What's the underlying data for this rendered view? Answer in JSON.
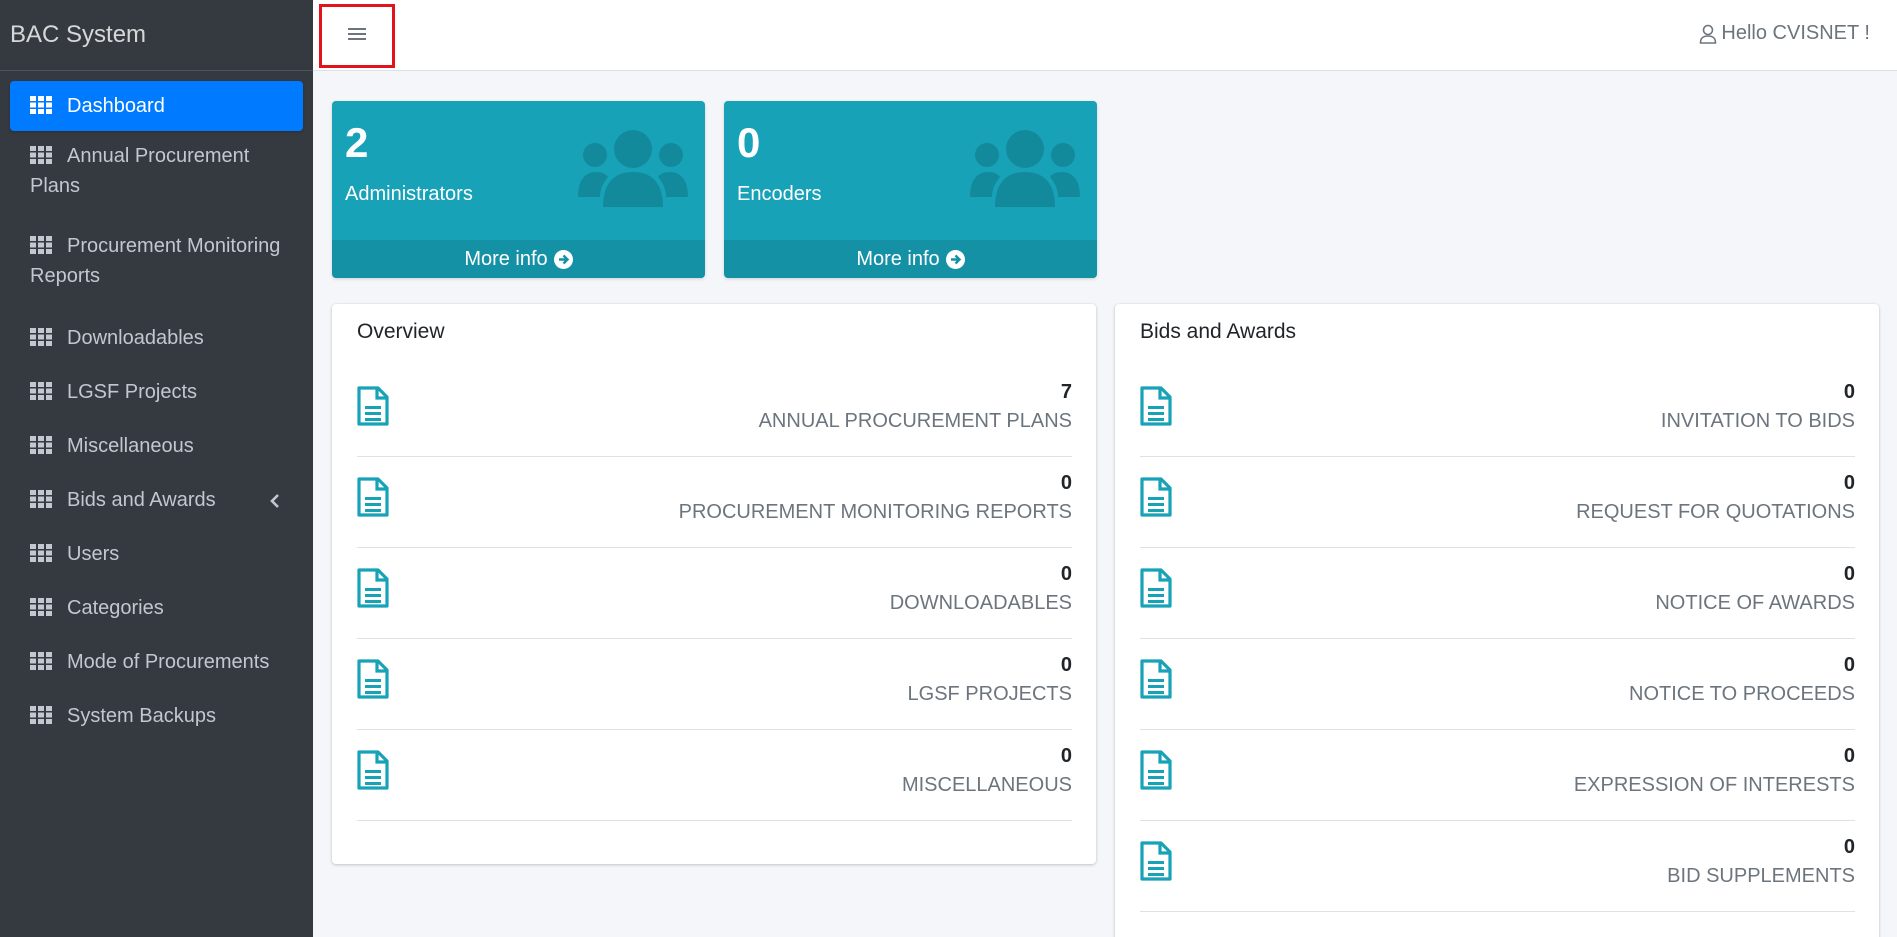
{
  "sidebar": {
    "brand": "BAC System",
    "items": [
      {
        "label": "Dashboard"
      },
      {
        "label": "Annual Procurement Plans"
      },
      {
        "label": "Procurement Monitoring Reports"
      },
      {
        "label": "Downloadables"
      },
      {
        "label": "LGSF Projects"
      },
      {
        "label": "Miscellaneous"
      },
      {
        "label": "Bids and Awards"
      },
      {
        "label": "Users"
      },
      {
        "label": "Categories"
      },
      {
        "label": "Mode of Procurements"
      },
      {
        "label": "System Backups"
      }
    ]
  },
  "header": {
    "user_greeting": "Hello CVISNET !"
  },
  "boxes": [
    {
      "count": "2",
      "label": "Administrators",
      "more": "More info"
    },
    {
      "count": "0",
      "label": "Encoders",
      "more": "More info"
    }
  ],
  "overview": {
    "title": "Overview",
    "rows": [
      {
        "count": "7",
        "label": "ANNUAL PROCUREMENT PLANS"
      },
      {
        "count": "0",
        "label": "PROCUREMENT MONITORING REPORTS"
      },
      {
        "count": "0",
        "label": "DOWNLOADABLES"
      },
      {
        "count": "0",
        "label": "LGSF PROJECTS"
      },
      {
        "count": "0",
        "label": "MISCELLANEOUS"
      }
    ]
  },
  "bids": {
    "title": "Bids and Awards",
    "rows": [
      {
        "count": "0",
        "label": "INVITATION TO BIDS"
      },
      {
        "count": "0",
        "label": "REQUEST FOR QUOTATIONS"
      },
      {
        "count": "0",
        "label": "NOTICE OF AWARDS"
      },
      {
        "count": "0",
        "label": "NOTICE TO PROCEEDS"
      },
      {
        "count": "0",
        "label": "EXPRESSION OF INTERESTS"
      },
      {
        "count": "0",
        "label": "BID SUPPLEMENTS"
      }
    ]
  },
  "colors": {
    "sidebar_bg": "#343a40",
    "active": "#007bff",
    "box": "#17a2b8",
    "icon_teal": "#17a2b8",
    "highlight": "#e3131b"
  },
  "icons": {
    "nav": "th-icon",
    "menu": "bars-icon",
    "user": "user-icon",
    "box": "users-icon",
    "more": "arrow-circle-right-icon",
    "row": "file-alt-icon",
    "caret": "angle-left-icon"
  }
}
